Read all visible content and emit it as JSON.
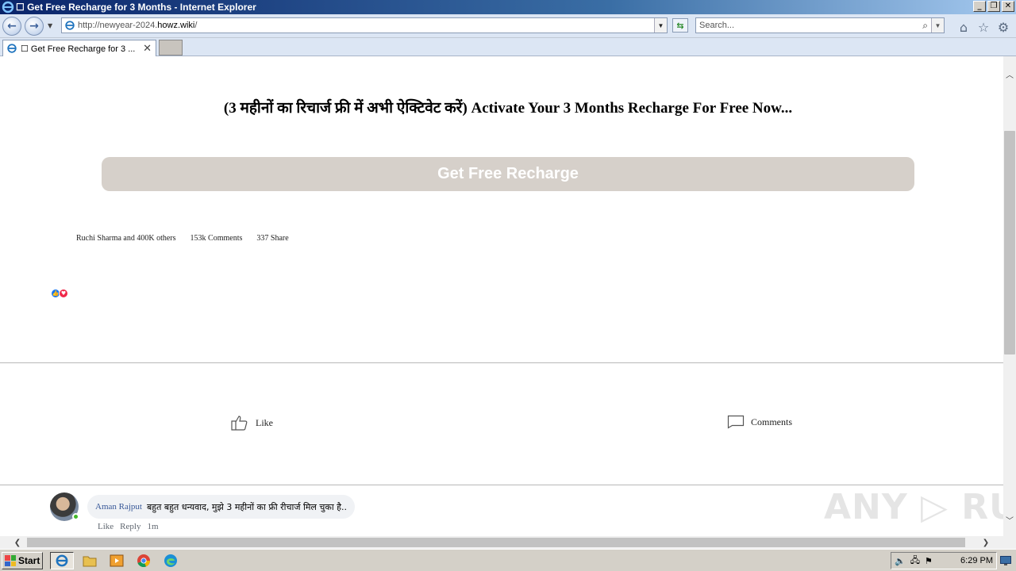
{
  "window": {
    "title": "☐ Get Free Recharge for 3 Months - Internet Explorer",
    "controls": {
      "minimize": "_",
      "restore": "❐",
      "close": "✕"
    }
  },
  "navbar": {
    "url_prefix": "http://newyear-2024.",
    "url_host": "howz.wiki",
    "url_suffix": "/",
    "search_placeholder": "Search..."
  },
  "tab": {
    "label": "☐ Get Free Recharge for 3 ...",
    "close": "✕"
  },
  "page": {
    "headline": "(3 महीनों का रिचार्ज फ्री में अभी ऐक्टिवेट करें) Activate Your 3 Months Recharge For Free Now...",
    "cta_label": "Get Free Recharge",
    "stats": {
      "reactors": "Ruchi Sharma and 400K others",
      "comments": "153k  Comments",
      "shares": "337  Share"
    },
    "actions": {
      "like": "Like",
      "comments": "Comments"
    },
    "comment": {
      "author": "Aman Rajput",
      "text": "बहुत बहुत धन्यवाद, मुझे 3 महीनों का फ्री रीचार्ज मिल चुका है..",
      "like": "Like",
      "reply": "Reply",
      "time": "1m"
    },
    "watermark": "ANY ▷ RUN"
  },
  "taskbar": {
    "start_label": "Start",
    "clock": "6:29 PM"
  },
  "colors": {
    "cta_bg": "#d6d0ca",
    "title_bar": "#0a246a",
    "like_blue": "#1877f2",
    "love_red": "#f02849"
  }
}
